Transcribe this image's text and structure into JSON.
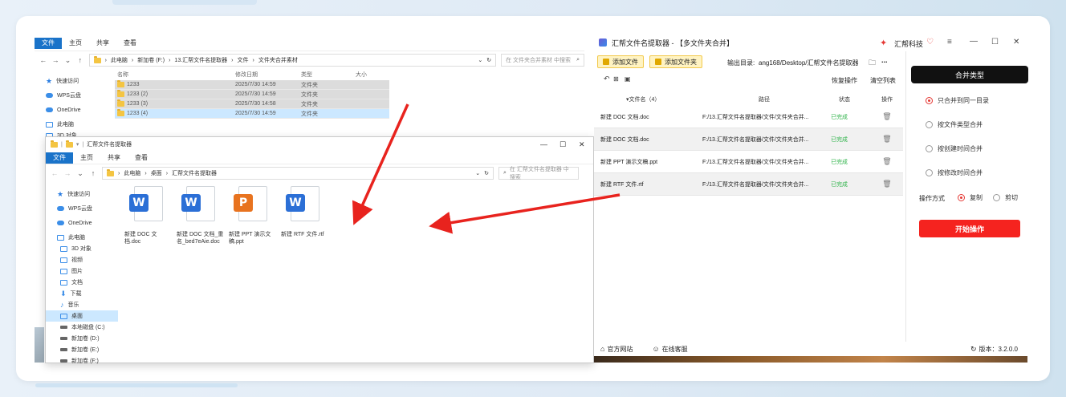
{
  "explorer_back": {
    "ribbon": {
      "tab_file": "文件",
      "tab_home": "主页",
      "tab_share": "共享",
      "tab_view": "查看"
    },
    "address": [
      "此电脑",
      "新加卷 (F:)",
      "13.汇帮文件名提取器",
      "文件",
      "文件夹合并素材"
    ],
    "search_placeholder": "在 文件夹合并素材 中搜索",
    "nav": [
      "快速访问",
      "WPS云盘",
      "OneDrive",
      "此电脑",
      "3D 对象"
    ],
    "columns": {
      "name": "名称",
      "date": "修改日期",
      "type": "类型",
      "size": "大小"
    },
    "rows": [
      {
        "name": "1233",
        "date": "2025/7/30 14:59",
        "type": "文件夹"
      },
      {
        "name": "1233 (2)",
        "date": "2025/7/30 14:59",
        "type": "文件夹"
      },
      {
        "name": "1233 (3)",
        "date": "2025/7/30 14:58",
        "type": "文件夹"
      },
      {
        "name": "1233 (4)",
        "date": "2025/7/30 14:59",
        "type": "文件夹"
      }
    ]
  },
  "explorer_front": {
    "title": "汇帮文件名提取器",
    "ribbon": {
      "tab_file": "文件",
      "tab_home": "主页",
      "tab_share": "共享",
      "tab_view": "查看"
    },
    "address": [
      "此电脑",
      "桌面",
      "汇帮文件名提取器"
    ],
    "search_placeholder": "在 汇帮文件名提取器 中搜索",
    "nav": [
      "快速访问",
      "WPS云盘",
      "OneDrive",
      "此电脑",
      "3D 对象",
      "视频",
      "图片",
      "文档",
      "下载",
      "音乐",
      "桌面",
      "本地磁盘 (C:)",
      "新加卷 (D:)",
      "新加卷 (E:)",
      "新加卷 (F:)"
    ],
    "files": [
      {
        "name": "新建 DOC 文档.doc",
        "letter": "W",
        "color": "#2b6fd6"
      },
      {
        "name": "新建 DOC 文档_重名_bed7eAie.doc",
        "letter": "W",
        "color": "#2b6fd6"
      },
      {
        "name": "新建 PPT 演示文稿.ppt",
        "letter": "P",
        "color": "#e8731f"
      },
      {
        "name": "新建 RTF 文件.rtf",
        "letter": "W",
        "color": "#2b6fd6"
      }
    ]
  },
  "app": {
    "title": "汇帮文件名提取器 - 【多文件夹合并】",
    "brand": "汇帮科技",
    "add_file": "添加文件",
    "add_folder": "添加文件夹",
    "output_label": "输出目录: ",
    "output_path": "ang168/Desktop/汇帮文件名提取器",
    "more": "...",
    "undo_label": "恢复操作",
    "clear_label": "清空列表",
    "columns": {
      "name": "▾文件名（4）",
      "path": "路径",
      "status": "状态",
      "op": "操作"
    },
    "rows": [
      {
        "name": "新建 DOC 文档.doc",
        "path": "F:/13.汇帮文件名提取器/文件/文件夹合并...",
        "status": "已完成"
      },
      {
        "name": "新建 DOC 文档.doc",
        "path": "F:/13.汇帮文件名提取器/文件/文件夹合并...",
        "status": "已完成"
      },
      {
        "name": "新建 PPT 演示文稿.ppt",
        "path": "F:/13.汇帮文件名提取器/文件/文件夹合并...",
        "status": "已完成"
      },
      {
        "name": "新建 RTF 文件.rtf",
        "path": "F:/13.汇帮文件名提取器/文件/文件夹合并...",
        "status": "已完成"
      }
    ],
    "merge_type_label": "合并类型",
    "merge_options": [
      "只合并到同一目录",
      "按文件类型合并",
      "按创建时间合并",
      "按修改时间合并"
    ],
    "op_mode_label": "操作方式",
    "op_copy": "复制",
    "op_cut": "剪切",
    "start_button": "开始操作",
    "footer_site": "官方网站",
    "footer_support": "在线客服",
    "version": "版本：3.2.0.0"
  },
  "colors": {
    "accent_red": "#f5231f",
    "accent_blue": "#1a73c9",
    "status_green": "#2fb34a",
    "dark_button": "#111111"
  }
}
